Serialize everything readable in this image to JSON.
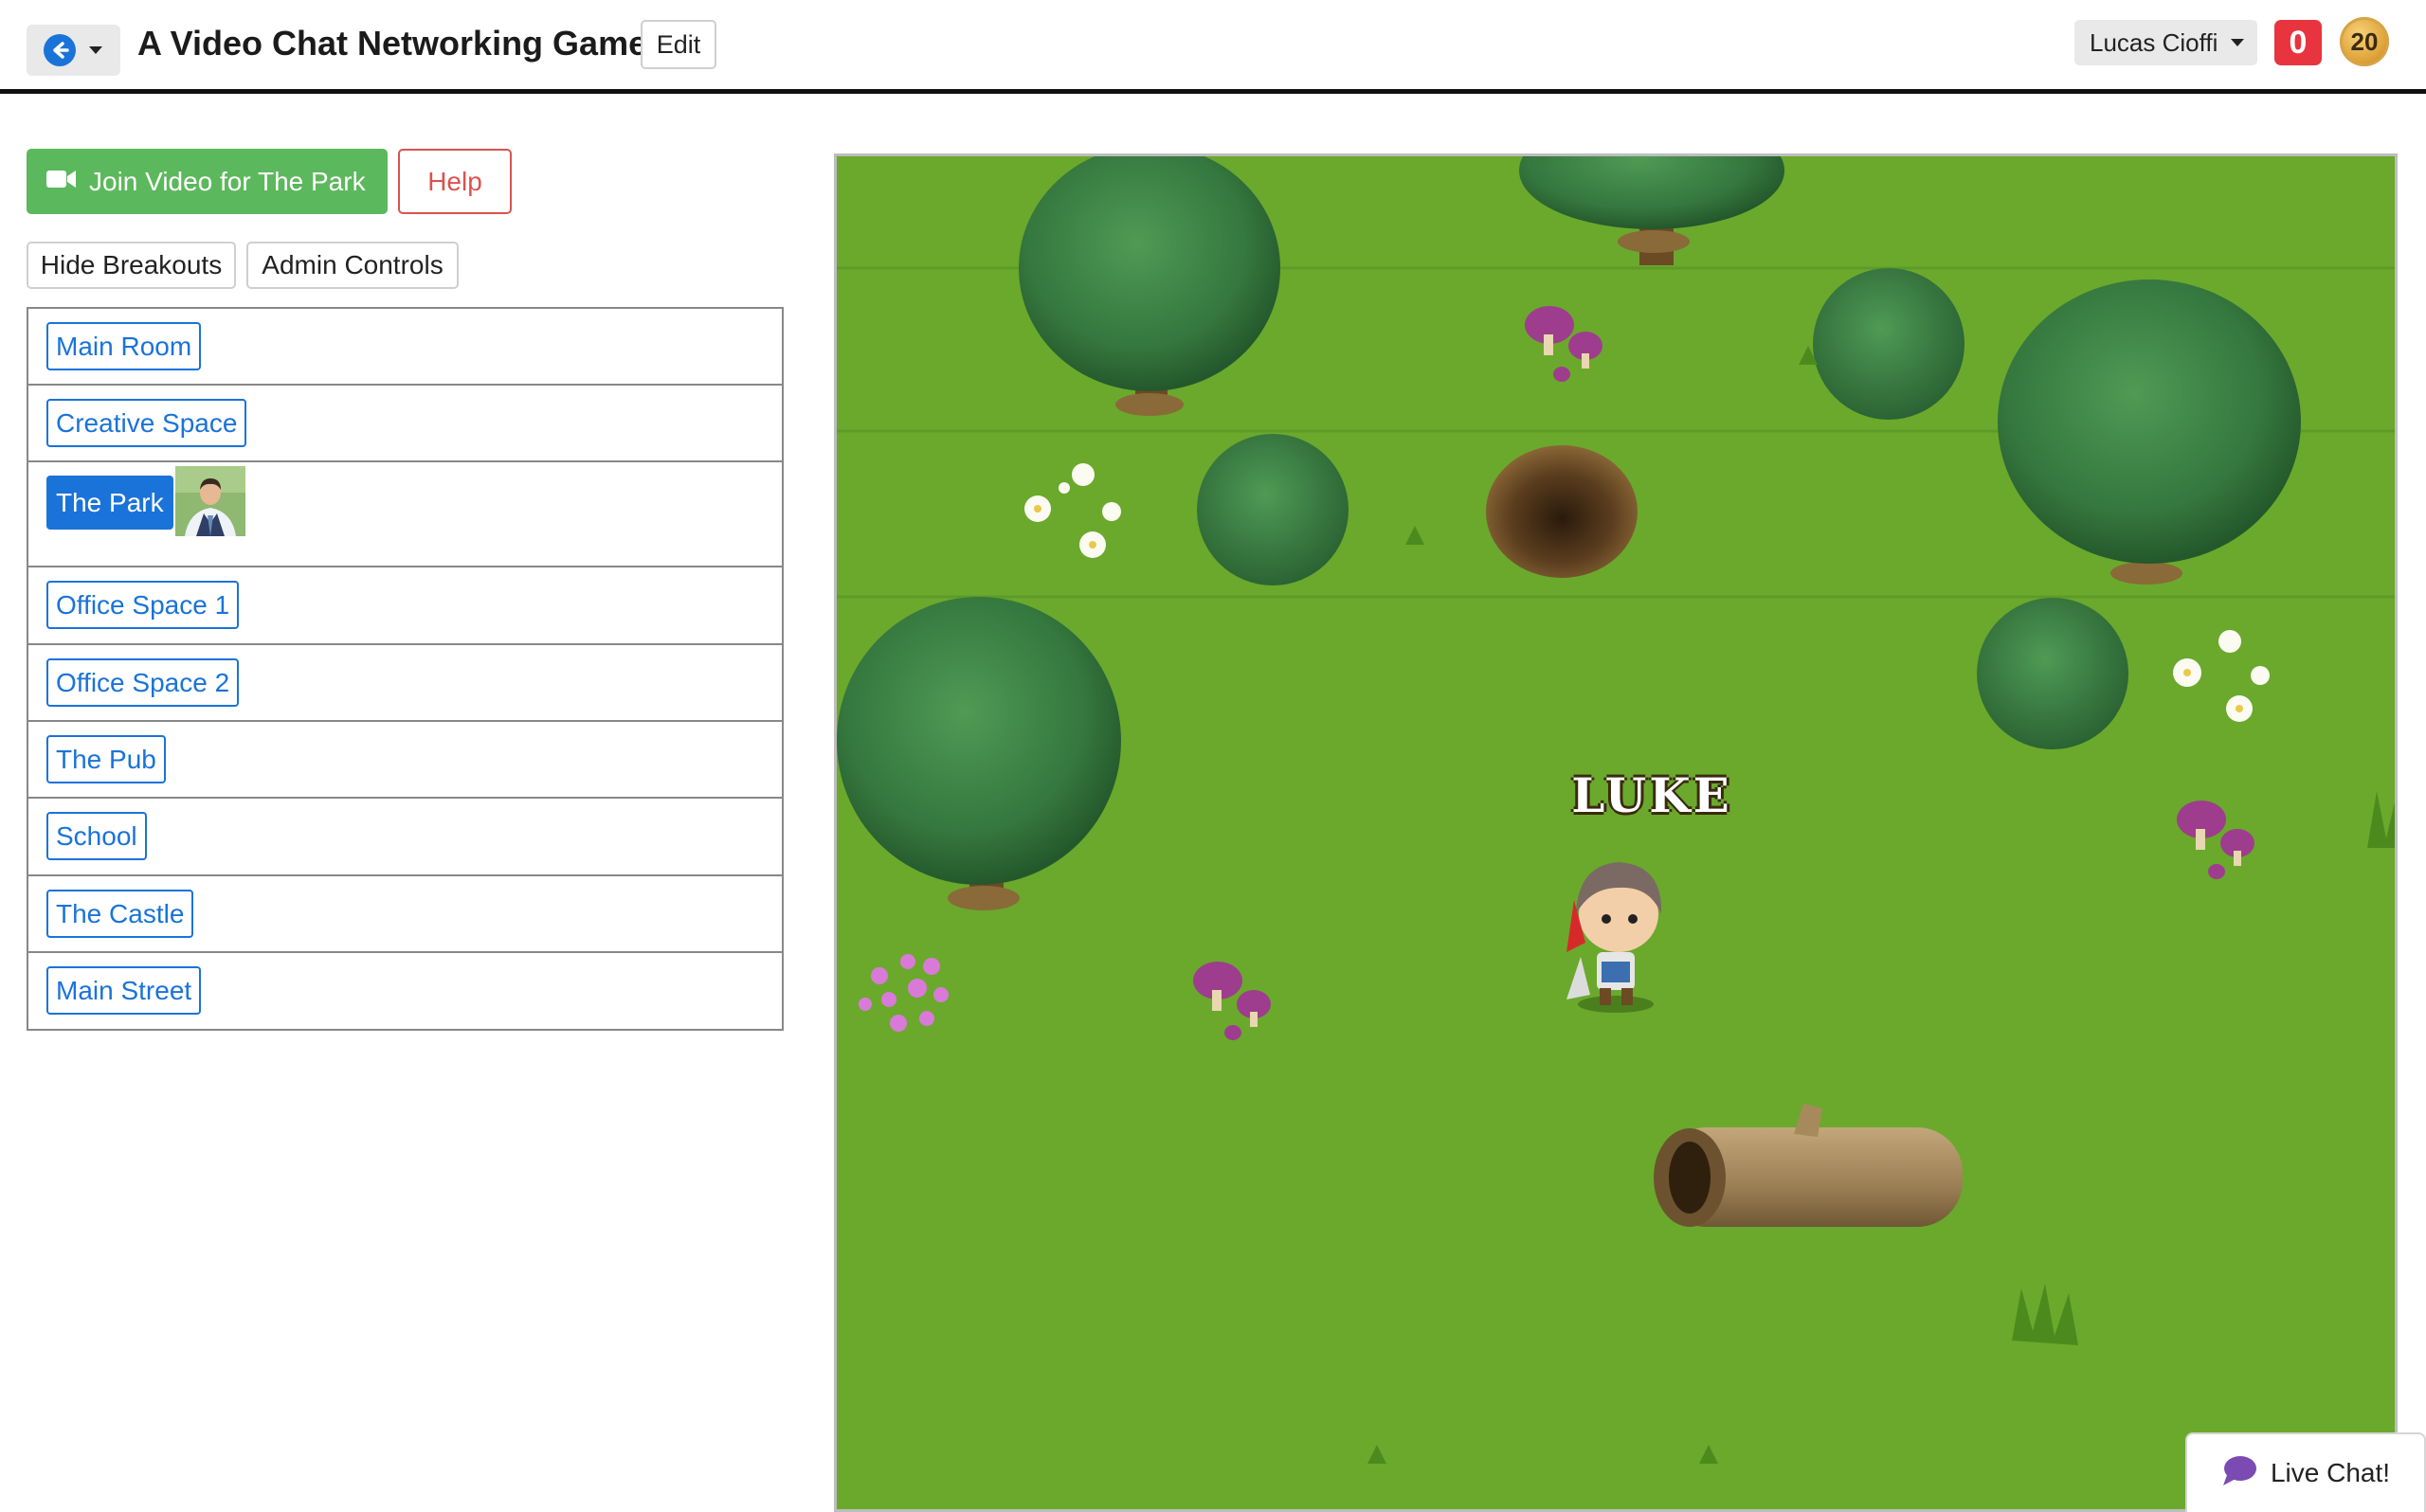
{
  "header": {
    "title": "A Video Chat Networking Game",
    "edit_label": "Edit",
    "user_name": "Lucas Cioffi",
    "notifications": "0",
    "points": "20"
  },
  "controls": {
    "join_video_label": "Join Video for The Park",
    "help_label": "Help",
    "hide_breakouts_label": "Hide Breakouts",
    "admin_controls_label": "Admin Controls"
  },
  "rooms": [
    {
      "label": "Main Room",
      "active": false
    },
    {
      "label": "Creative Space",
      "active": false
    },
    {
      "label": "The Park",
      "active": true
    },
    {
      "label": "Office Space 1",
      "active": false
    },
    {
      "label": "Office Space 2",
      "active": false
    },
    {
      "label": "The Pub",
      "active": false
    },
    {
      "label": "School",
      "active": false
    },
    {
      "label": "The Castle",
      "active": false
    },
    {
      "label": "Main Street",
      "active": false
    }
  ],
  "game": {
    "player_name": "LUKE"
  },
  "live_chat": {
    "label": "Live Chat!"
  },
  "colors": {
    "accent": "#1a73d9",
    "success": "#5cb85c",
    "danger": "#d9534f",
    "badge": "#e8343f",
    "grass": "#6aa92c",
    "chat_icon": "#7b4bb3"
  },
  "icons": {
    "back": "arrow-left-circle-icon",
    "video": "video-camera-icon",
    "chat": "speech-bubble-icon",
    "coin": "coin-icon"
  }
}
